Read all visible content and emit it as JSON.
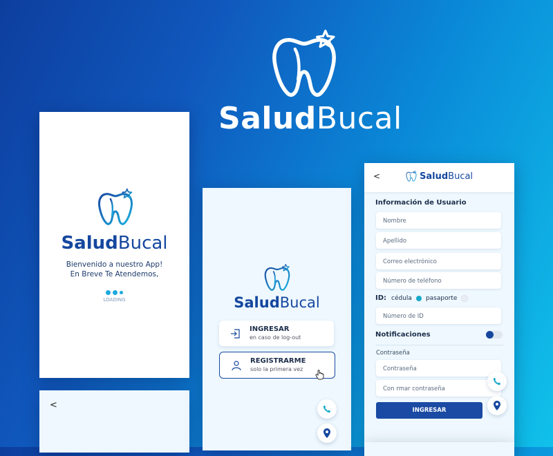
{
  "hero": {
    "brand_bold": "Salud",
    "brand_light": "Bucal"
  },
  "splash": {
    "brand_bold": "Salud",
    "brand_light": "Bucal",
    "welcome_line1": "Bienvenido a nuestro App!",
    "welcome_line2": "En Breve Te Atendemos,",
    "loading": "LOADING"
  },
  "partial_left": {
    "back": "<"
  },
  "login": {
    "brand_bold": "Salud",
    "brand_light": "Bucal",
    "ingresar": {
      "title": "INGRESAR",
      "subtitle": "en caso de log-out"
    },
    "registrarme": {
      "title": "REGISTRARME",
      "subtitle": "solo la primera vez"
    }
  },
  "form": {
    "back": "<",
    "brand_bold": "Salud",
    "brand_light": "Bucal",
    "section_title": "Información de Usuario",
    "fields": {
      "nombre": "Nombre",
      "apellido": "Apellido",
      "correo": "Correo electrónico",
      "telefono": "Número de teléfono",
      "numero_id": "Número de ID",
      "contrasena": "Contraseña",
      "confirmar": "Con rmar contraseña"
    },
    "id_label": "ID:",
    "id_options": [
      "cédula",
      "pasaporte"
    ],
    "id_selected": "cédula",
    "notificaciones": "Notificaciones",
    "notificaciones_on": true,
    "password_label": "Contraseña",
    "submit": "INGRESAR"
  },
  "colors": {
    "brand_dark": "#15479f",
    "brand_light": "#1aa9df",
    "accent_teal": "#16a9c9"
  },
  "icons": [
    "tooth-logo-icon",
    "login-icon",
    "user-icon",
    "phone-icon",
    "location-pin-icon",
    "hand-cursor-icon"
  ]
}
